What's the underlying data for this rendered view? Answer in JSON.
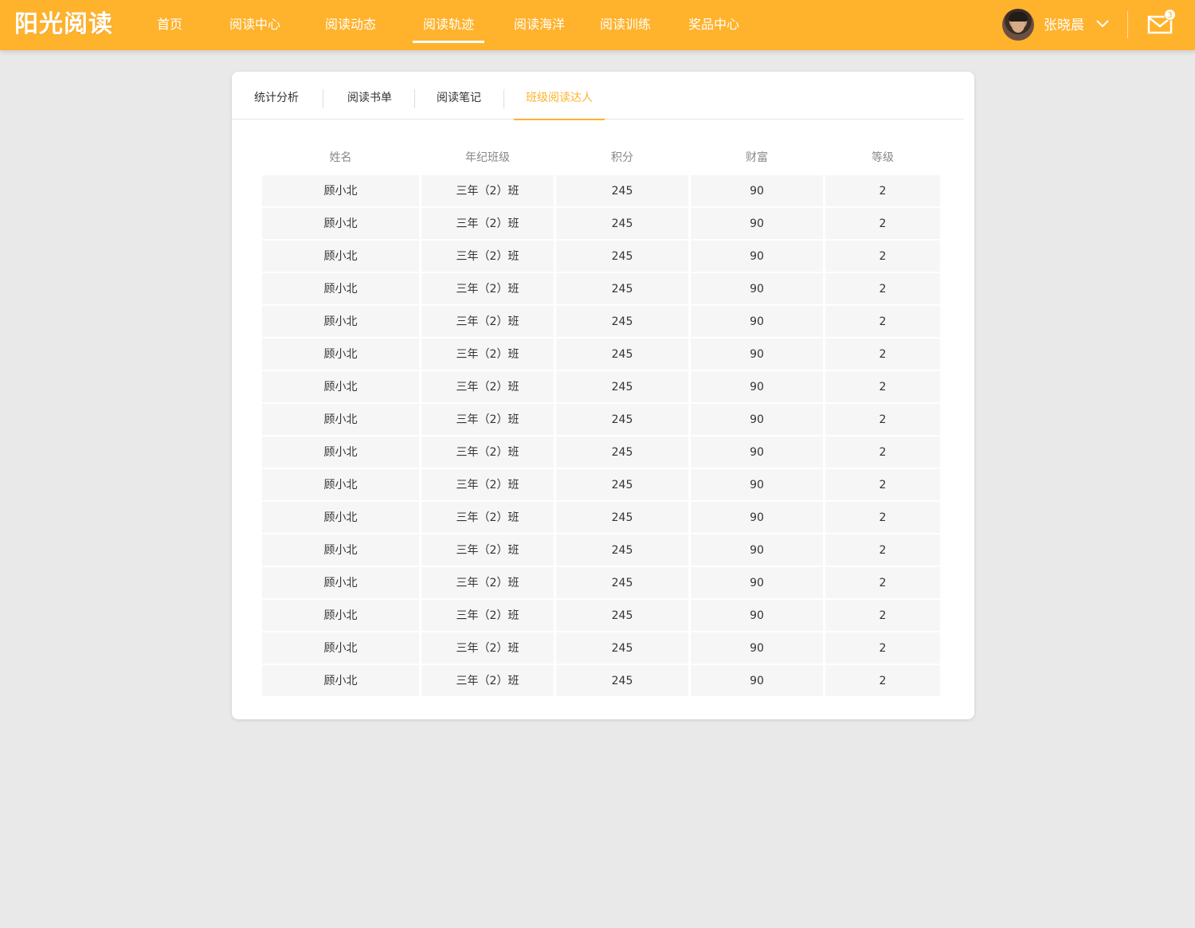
{
  "header": {
    "logo": "阳光阅读",
    "nav": [
      {
        "label": "首页",
        "active": false
      },
      {
        "label": "阅读中心",
        "active": false
      },
      {
        "label": "阅读动态",
        "active": false
      },
      {
        "label": "阅读轨迹",
        "active": true
      },
      {
        "label": "阅读海洋",
        "active": false
      },
      {
        "label": "阅读训练",
        "active": false
      },
      {
        "label": "奖品中心",
        "active": false
      }
    ],
    "user_name": "张晓晨",
    "mail_count": "3"
  },
  "tabs": [
    {
      "label": "统计分析",
      "active": false
    },
    {
      "label": "阅读书单",
      "active": false
    },
    {
      "label": "阅读笔记",
      "active": false
    },
    {
      "label": "班级阅读达人",
      "active": true
    }
  ],
  "table": {
    "columns": [
      "姓名",
      "年纪班级",
      "积分",
      "财富",
      "等级"
    ],
    "rows": [
      [
        "顾小北",
        "三年（2）班",
        "245",
        "90",
        "2"
      ],
      [
        "顾小北",
        "三年（2）班",
        "245",
        "90",
        "2"
      ],
      [
        "顾小北",
        "三年（2）班",
        "245",
        "90",
        "2"
      ],
      [
        "顾小北",
        "三年（2）班",
        "245",
        "90",
        "2"
      ],
      [
        "顾小北",
        "三年（2）班",
        "245",
        "90",
        "2"
      ],
      [
        "顾小北",
        "三年（2）班",
        "245",
        "90",
        "2"
      ],
      [
        "顾小北",
        "三年（2）班",
        "245",
        "90",
        "2"
      ],
      [
        "顾小北",
        "三年（2）班",
        "245",
        "90",
        "2"
      ],
      [
        "顾小北",
        "三年（2）班",
        "245",
        "90",
        "2"
      ],
      [
        "顾小北",
        "三年（2）班",
        "245",
        "90",
        "2"
      ],
      [
        "顾小北",
        "三年（2）班",
        "245",
        "90",
        "2"
      ],
      [
        "顾小北",
        "三年（2）班",
        "245",
        "90",
        "2"
      ],
      [
        "顾小北",
        "三年（2）班",
        "245",
        "90",
        "2"
      ],
      [
        "顾小北",
        "三年（2）班",
        "245",
        "90",
        "2"
      ],
      [
        "顾小北",
        "三年（2）班",
        "245",
        "90",
        "2"
      ],
      [
        "顾小北",
        "三年（2）班",
        "245",
        "90",
        "2"
      ]
    ]
  },
  "colors": {
    "brand": "#ffb22b",
    "page_bg": "#e9e9e9",
    "row_bg": "#f6f6f6"
  }
}
